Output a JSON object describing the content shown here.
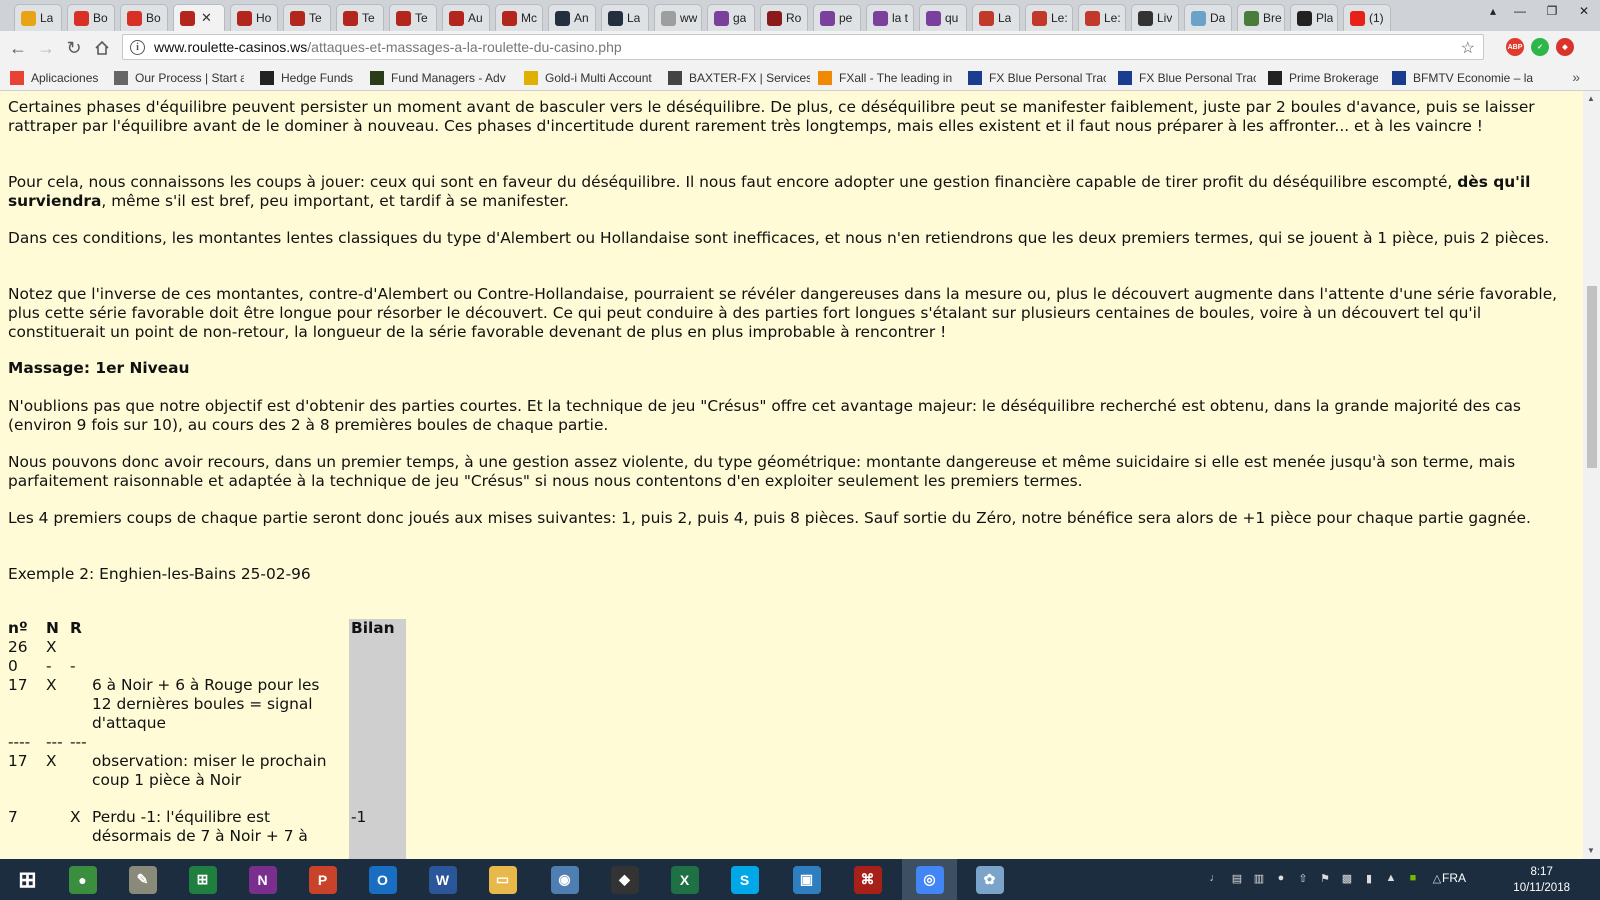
{
  "browser": {
    "tabs": [
      {
        "label": "La",
        "icon": "mail-icon",
        "color": "#e8a317"
      },
      {
        "label": "Bo",
        "icon": "gmail-icon",
        "color": "#d93025"
      },
      {
        "label": "Bo",
        "icon": "gmail-icon",
        "color": "#d93025"
      },
      {
        "label": "",
        "icon": "roulette-icon",
        "color": "#b3261e",
        "active": true
      },
      {
        "label": "Ho",
        "icon": "roulette-icon",
        "color": "#b3261e"
      },
      {
        "label": "Te",
        "icon": "roulette-icon",
        "color": "#b3261e"
      },
      {
        "label": "Te",
        "icon": "roulette-icon",
        "color": "#b3261e"
      },
      {
        "label": "Te",
        "icon": "roulette-icon",
        "color": "#b3261e"
      },
      {
        "label": "Au",
        "icon": "roulette-icon",
        "color": "#b3261e"
      },
      {
        "label": "Mc",
        "icon": "roulette-icon",
        "color": "#b3261e"
      },
      {
        "label": "An",
        "icon": "amazon-icon",
        "color": "#232f3e"
      },
      {
        "label": "La",
        "icon": "amazon-icon",
        "color": "#232f3e"
      },
      {
        "label": "ww",
        "icon": "page-icon",
        "color": "#9e9e9e"
      },
      {
        "label": "ga",
        "icon": "m-icon",
        "color": "#7b3f9c"
      },
      {
        "label": "Ro",
        "icon": "sj-icon",
        "color": "#8b1a1a"
      },
      {
        "label": "pe",
        "icon": "m-icon",
        "color": "#7b3f9c"
      },
      {
        "label": "la t",
        "icon": "m-icon",
        "color": "#7b3f9c"
      },
      {
        "label": "qu",
        "icon": "m-icon",
        "color": "#7b3f9c"
      },
      {
        "label": "La",
        "icon": "roulette-icon",
        "color": "#c0392b"
      },
      {
        "label": "Le:",
        "icon": "roulette-icon",
        "color": "#c0392b"
      },
      {
        "label": "Le:",
        "icon": "roulette-icon",
        "color": "#c0392b"
      },
      {
        "label": "Liv",
        "icon": "plus-icon",
        "color": "#333333"
      },
      {
        "label": "Da",
        "icon": "dance-icon",
        "color": "#6aa3c7"
      },
      {
        "label": "Bre",
        "icon": "bre-icon",
        "color": "#4a7d3a"
      },
      {
        "label": "Pla",
        "icon": "pla-icon",
        "color": "#222222"
      },
      {
        "label": "(1)",
        "icon": "youtube-icon",
        "color": "#e62117"
      }
    ],
    "window_controls": {
      "profile": "▴",
      "minimize": "—",
      "maximize": "❐",
      "close": "✕"
    },
    "url_host": "www.roulette-casinos.ws",
    "url_path": "/attaques-et-massages-a-la-roulette-du-casino.php",
    "extensions": [
      {
        "name": "adblock-plus-icon",
        "text": "ABP",
        "color": "#e23b2e"
      },
      {
        "name": "check-extension-icon",
        "text": "✓",
        "color": "#2eb64a"
      },
      {
        "name": "alert-extension-icon",
        "text": "◆",
        "color": "#d9342b"
      }
    ],
    "bookmarks": [
      {
        "label": "Aplicaciones",
        "icon": "apps-grid-icon",
        "color": "#e94235"
      },
      {
        "label": "Our Process | Start a",
        "icon": "page-icon",
        "color": "#666666"
      },
      {
        "label": "Hedge Funds",
        "icon": "sh-icon",
        "color": "#222222"
      },
      {
        "label": "Fund Managers - Adv",
        "icon": "fm-icon",
        "color": "#2a3b1a"
      },
      {
        "label": "Gold-i Multi Account",
        "icon": "gold-i-icon",
        "color": "#e0b000"
      },
      {
        "label": "BAXTER-FX | Services",
        "icon": "baxter-icon",
        "color": "#444444"
      },
      {
        "label": "FXall - The leading in",
        "icon": "fxall-icon",
        "color": "#f08a00"
      },
      {
        "label": "FX Blue Personal Trac",
        "icon": "fxblue-icon",
        "color": "#1b3d8f"
      },
      {
        "label": "FX Blue Personal Trac",
        "icon": "fxblue-icon",
        "color": "#1b3d8f"
      },
      {
        "label": "Prime Brokerage",
        "icon": "prime-icon",
        "color": "#222222"
      },
      {
        "label": "BFMTV Economie – la",
        "icon": "bfmtv-icon",
        "color": "#1a3c8c"
      }
    ]
  },
  "article": {
    "paragraphs": [
      "Certaines phases d'équilibre peuvent persister un moment avant de basculer vers le déséquilibre. De plus, ce déséquilibre peut se manifester faiblement, juste par 2 boules d'avance, puis se laisser rattraper par l'équilibre avant de le dominer à nouveau. Ces phases d'incertitude durent rarement très longtemps, mais elles existent et il faut nous préparer à les affronter... et à les vaincre !",
      "Pour cela, nous connaissons les coups à jouer: ceux qui sont en faveur du déséquilibre. Il nous faut encore adopter une gestion financière capable de tirer profit du déséquilibre escompté,",
      "dès qu'il surviendra",
      ", même s'il est bref, peu important, et tardif à se manifester.",
      "Dans ces conditions, les montantes lentes classiques du type d'Alembert ou Hollandaise sont inefficaces, et nous n'en retiendrons que les deux premiers termes, qui se jouent à 1 pièce, puis 2 pièces.",
      "Notez que l'inverse de ces montantes, contre-d'Alembert ou Contre-Hollandaise, pourraient se révéler dangereuses dans la mesure ou, plus le découvert augmente dans l'attente d'une série favorable, plus cette série favorable doit être longue pour résorber le découvert. Ce qui peut conduire à des parties fort longues s'étalant sur plusieurs centaines de boules, voire à un découvert tel qu'il constituerait un point de non-retour, la longueur de la série favorable devenant de plus en plus improbable à rencontrer !",
      "Massage: 1er Niveau",
      "N'oublions pas que notre objectif est d'obtenir des parties courtes. Et la technique de jeu \"Crésus\" offre cet avantage majeur: le déséquilibre recherché est obtenu, dans la grande majorité des cas (environ 9 fois sur 10), au cours des 2 à 8 premières boules de chaque partie.",
      "Nous pouvons donc avoir recours, dans un premier temps, à une gestion assez violente, du type géométrique: montante dangereuse et même suicidaire si elle est menée jusqu'à son terme, mais parfaitement raisonnable et adaptée à la technique de jeu \"Crésus\" si nous nous contentons d'en exploiter seulement les premiers termes.",
      "Les 4 premiers coups de chaque partie seront donc joués aux mises suivantes: 1, puis 2, puis 4, puis 8 pièces. Sauf sortie du Zéro, notre bénéfice sera alors de +1 pièce pour chaque partie gagnée.",
      "Exemple 2: Enghien-les-Bains 25-02-96"
    ],
    "table": {
      "headers": {
        "num": "nº",
        "n": "N",
        "r": "R",
        "bilan": "Bilan"
      },
      "rows": [
        {
          "num": "26",
          "n": "X",
          "r": "",
          "comment": "",
          "bilan": ""
        },
        {
          "num": "0",
          "n": "-",
          "r": "-",
          "comment": "",
          "bilan": ""
        },
        {
          "num": "17",
          "n": "X",
          "r": "",
          "comment": "6 à Noir + 6 à Rouge pour les 12 dernières boules = signal d'attaque",
          "bilan": ""
        },
        {
          "num": "----",
          "n": "---",
          "r": "---",
          "comment": "",
          "bilan": ""
        },
        {
          "num": "17",
          "n": "X",
          "r": "",
          "comment": "observation: miser le prochain coup 1 pièce à Noir",
          "bilan": ""
        },
        {
          "num": "7",
          "n": "",
          "r": "X",
          "comment": "Perdu -1: l'équilibre est désormais de 7 à Noir + 7 à",
          "bilan": "-1"
        }
      ]
    }
  },
  "taskbar": {
    "apps": [
      {
        "name": "start-button",
        "text": "⊞",
        "color": "transparent"
      },
      {
        "name": "chrome-taskbar-icon",
        "text": "●",
        "color": "#3b8e3e"
      },
      {
        "name": "notepad-taskbar-icon",
        "text": "✎",
        "color": "#8a8a7a"
      },
      {
        "name": "excel-calc-taskbar-icon",
        "text": "⊞",
        "color": "#1e7f3e"
      },
      {
        "name": "onenote-taskbar-icon",
        "text": "N",
        "color": "#7a2f8f"
      },
      {
        "name": "powerpoint-taskbar-icon",
        "text": "P",
        "color": "#c9432b"
      },
      {
        "name": "outlook-taskbar-icon",
        "text": "O",
        "color": "#1a6ec2"
      },
      {
        "name": "word-taskbar-icon",
        "text": "W",
        "color": "#2b5699"
      },
      {
        "name": "file-explorer-taskbar-icon",
        "text": "▭",
        "color": "#e8b84a"
      },
      {
        "name": "owl-app-taskbar-icon",
        "text": "◉",
        "color": "#4f7fb0"
      },
      {
        "name": "cat-app-taskbar-icon",
        "text": "◆",
        "color": "#333333"
      },
      {
        "name": "excel-taskbar-icon",
        "text": "X",
        "color": "#1e7145"
      },
      {
        "name": "skype-taskbar-icon",
        "text": "S",
        "color": "#00a8e8"
      },
      {
        "name": "remote-app-taskbar-icon",
        "text": "▣",
        "color": "#2f7fc0"
      },
      {
        "name": "acrobat-taskbar-icon",
        "text": "⌘",
        "color": "#a8201a"
      },
      {
        "name": "chrome-active-taskbar-icon",
        "text": "◎",
        "color": "#4285f4"
      },
      {
        "name": "paint-taskbar-icon",
        "text": "✿",
        "color": "#7aa4c9"
      }
    ],
    "language": "FRA",
    "time": "8:17",
    "date": "10/11/2018"
  }
}
